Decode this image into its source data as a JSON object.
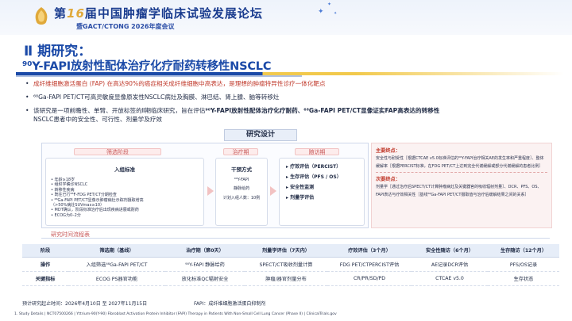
{
  "header": {
    "title_prefix": "第",
    "title_number": "16",
    "title_suffix": "届中国肿瘤学临床试验发展论坛",
    "subtitle": "暨GACT/CTONG 2026年度会议"
  },
  "phase_title": "Ⅱ 期研究：",
  "main_title": "⁹⁰Y-FAPI放射性配体治疗化疗耐药转移性NSCLC",
  "bullets": [
    {
      "red_part": "成纤维细胞激活蛋白 (FAP)",
      "rest": " 在高达90%的癌症相关成纤维细胞中高表达，是理想的肿瘤特异性诊疗一体化靶点",
      "red": true
    },
    {
      "text": "⁶⁸Ga-FAPI PET/CT可高灵敏度显像原发性NSCLC病灶及胸膜、淋巴结、肾上腺、脑等转移灶"
    },
    {
      "text_a": "该研究是一项前瞻性、单臂、开放标签的Ⅱ期临床研究，旨在评估",
      "bold_a": "⁹⁰Y-FAPI放射性配体治疗化疗耐药、⁶⁸Ga-FAPI PET/CT显像证实FAP高表达的转移性",
      "text_b": "NSCLC患者中的安全性、可行性、剂量学及疗效"
    }
  ],
  "design": {
    "title": "研究设计",
    "screening": {
      "label": "筛选阶段",
      "head": "入组标准",
      "items": [
        "• 年龄≥18岁",
        "• 组织学确诊NSCLC",
        "• 转移性疾病",
        "• 既往已行⁶⁸F-FDG PET/CT分期检查",
        "• ⁶⁸Ga-FAPI PET/CT显像示肿瘤病灶示踪剂摄取增高",
        "  （>50%病灶SUVmax≥10）",
        "• MDT确认，阶段标准治疗后出现疾病进展或耐药",
        "• ECOG为0–2分"
      ]
    },
    "treatment": {
      "label": "治疗期",
      "head": "干预方式",
      "drug": "⁹⁰Y-FAPI",
      "route": "静脉给药",
      "plan": "计划入组人数：10例"
    },
    "followup": {
      "label": "随访期",
      "items": [
        "▸ 疗效评估（PERCIST）",
        "▸ 生存评估（PFS / OS）",
        "▸ 安全性监测",
        "▸ 剂量学评估"
      ]
    }
  },
  "endpoints": {
    "primary_head": "主要终点：",
    "primary_text": "安全性与耐受性［根据CTCAE v5.0标准评估的⁹⁰Y-FAPI治疗相关AE的发生率和严重程度］、整体缓解率［根据PERCIST标准，在FDG PET/CT上达到完全代谢缓解或部分代谢缓解的患者比例］",
    "secondary_head": "次要终点：",
    "secondary_text": "剂量学［通过治疗后SPECT/CT计算肿瘤病灶及关键器官的吸收辐射剂量］、DCR、PFS、OS、FAPI表达与疗效相关性［基线⁶⁸Ga-FAPI PET/CT摄取值与治疗后缓解结果之间的关系］"
  },
  "flow": {
    "label": "研究时间流程表",
    "headers": [
      "阶段",
      "筛选期（基线）",
      "治疗期（第0天）",
      "剂量学评估（7天内）",
      "疗效评估（3个月）",
      "安全性随访（6个月）",
      "生存随访（12个月）"
    ],
    "rows": [
      {
        "name": "操作",
        "cells": [
          "入组筛选⁶⁸Ga-FAPI PET/CT",
          "⁹⁰Y-FAPI 静脉给药",
          "SPECT/CT吸收剂量计算",
          "FDG PET/CTPERCIST评估",
          "AE记录DCR评估",
          "PFS/OS记录"
        ]
      },
      {
        "name": "关键指标",
        "cells": [
          "ECOG PS器官功能",
          "放化标准QC辐射安全",
          "肿瘤/器官剂量分布",
          "CR/PR/SD/PD",
          "CTCAE v5.0",
          "生存状态"
        ]
      }
    ]
  },
  "enroll_period": "预计研究起止时间：2026年4月10日 至 2027年11月15日",
  "fapi_note": "FAPI：成纤维细胞激活蛋白抑制剂",
  "footnote": "1. Study Details | NCT07500266 | Yttrium-90(Y-90) Fibroblast Activation Protein Inhibitor (FAPI) Therapy in Patients With Non-Small Cell Lung Cancer (Phase II) | ClinicalTrials.gov",
  "colors": {
    "primary": "#1b4aa8",
    "accent_red": "#c0392b",
    "accent_yellow": "#f2c94c"
  }
}
